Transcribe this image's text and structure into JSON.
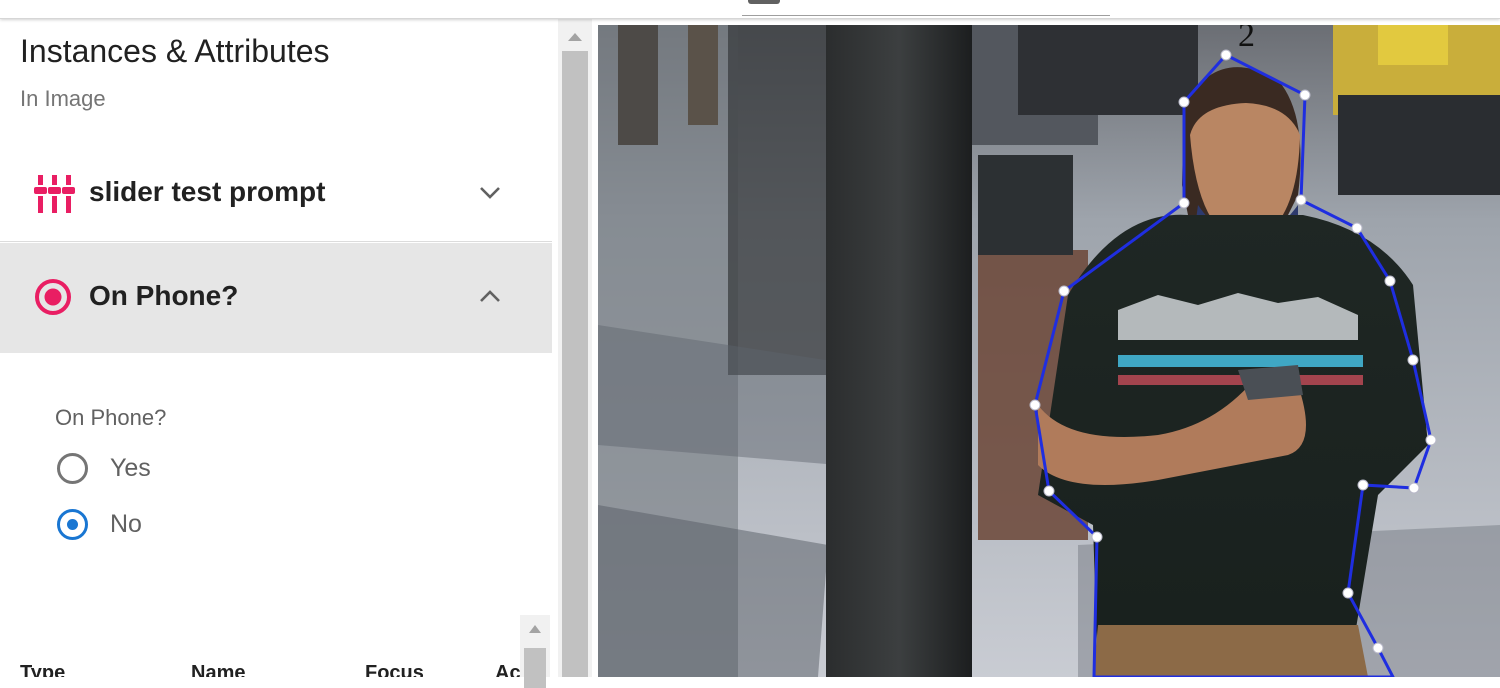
{
  "panel": {
    "title": "Instances & Attributes",
    "subtitle": "In Image",
    "sections": [
      {
        "label": "slider test prompt",
        "icon": "slider-icon",
        "expanded": false
      },
      {
        "label": "On Phone?",
        "icon": "radio-target-icon",
        "expanded": true
      }
    ],
    "attribute": {
      "question": "On Phone?",
      "options": [
        {
          "label": "Yes",
          "selected": false
        },
        {
          "label": "No",
          "selected": true
        }
      ]
    },
    "table_headers": [
      "Type",
      "Name",
      "Focus",
      "Ac"
    ]
  },
  "canvas": {
    "instance_label": "2",
    "polygon_color": "#1f2ee0",
    "vertex_color": "#ffffff"
  },
  "colors": {
    "accent": "#e91e63",
    "radio_selected": "#1976d2",
    "row_highlight": "#e6e6e6"
  }
}
